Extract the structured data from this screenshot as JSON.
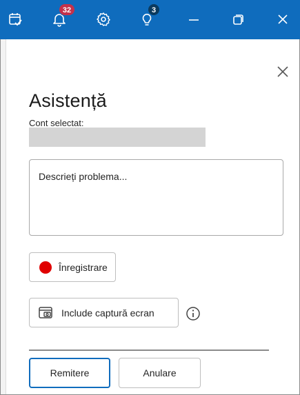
{
  "titlebar": {
    "accent_color": "#0f6cbd",
    "buttons": [
      {
        "icon": "calendar-check-icon"
      },
      {
        "icon": "bell-icon",
        "badge": "32",
        "badge_color": "#c4314b"
      },
      {
        "icon": "gear-icon"
      },
      {
        "icon": "lightbulb-icon",
        "badge": "3",
        "badge_color": "#0b3a5e"
      },
      {
        "icon": "minimize-icon"
      },
      {
        "icon": "restore-icon"
      },
      {
        "icon": "close-icon"
      }
    ]
  },
  "panel": {
    "title": "Asistență",
    "account_label": "Cont selectat:",
    "account_value": "",
    "description_placeholder": "Descrieți problema...",
    "record_label": "Înregistrare",
    "record_color": "#e00000",
    "screenshot_label": "Include captură ecran",
    "submit_label": "Remitere",
    "cancel_label": "Anulare"
  }
}
